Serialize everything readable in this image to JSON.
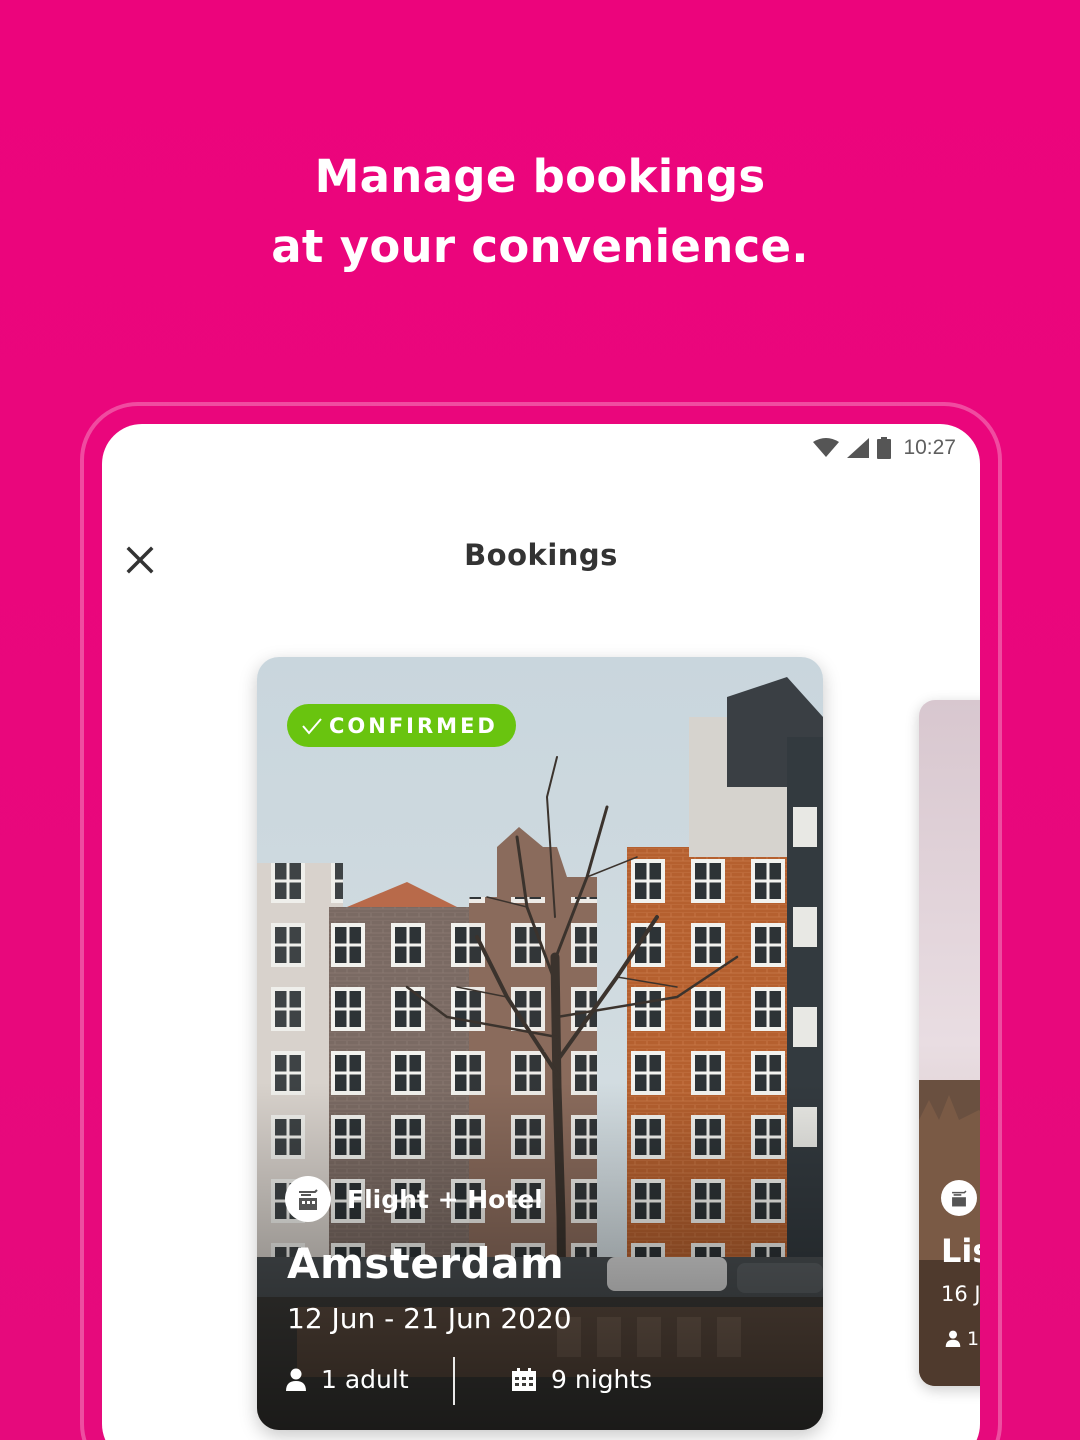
{
  "promo": {
    "headline_line1": "Manage bookings",
    "headline_line2": "at your convenience."
  },
  "colors": {
    "brand_magenta": "#ec047c",
    "confirmed_green": "#69c40f"
  },
  "status_bar": {
    "time": "10:27",
    "icons": [
      "wifi-icon",
      "signal-icon",
      "battery-icon"
    ]
  },
  "app_bar": {
    "title": "Bookings",
    "close_icon": "close-icon"
  },
  "bookings": [
    {
      "status": "CONFIRMED",
      "status_icon": "check-icon",
      "type": "Flight + Hotel",
      "type_icon": "flight-hotel-icon",
      "city": "Amsterdam",
      "dates": "12 Jun - 21 Jun 2020",
      "travellers": "1 adult",
      "travellers_icon": "person-icon",
      "nights": "9 nights",
      "nights_icon": "calendar-icon"
    },
    {
      "city": "Lis",
      "dates": "16 J",
      "travellers": "1",
      "type_icon": "flight-hotel-icon",
      "travellers_icon": "person-icon"
    }
  ]
}
